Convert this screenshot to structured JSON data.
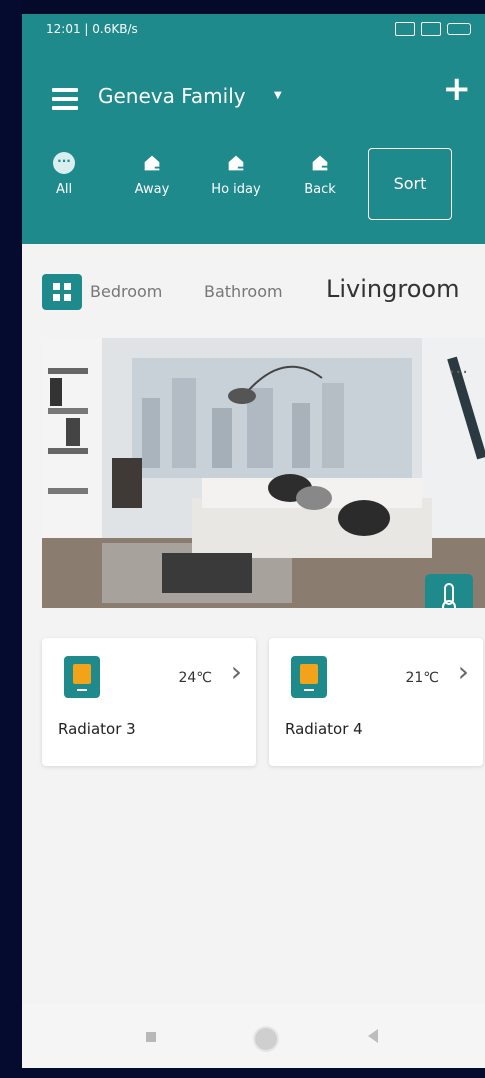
{
  "status_bar": {
    "time_speed": "12:01 | 0.6KB/s",
    "icons": [
      "signal-icon",
      "sim-icon",
      "battery-icon"
    ]
  },
  "header": {
    "family_name": "Geneva Family",
    "add_icon": "plus-icon",
    "menu_icon": "menu-icon"
  },
  "modes": [
    {
      "label": "All",
      "icon": "dots-circle-icon"
    },
    {
      "label": "Away",
      "icon": "house-arrow-out-icon"
    },
    {
      "label": "Ho iday",
      "icon": "house-arrow-in-icon"
    },
    {
      "label": "Back",
      "icon": "house-back-icon"
    }
  ],
  "sort_label": "Sort",
  "rooms": {
    "tabs": [
      "Bedroom",
      "Bathroom",
      "Livingroom"
    ],
    "active": "Livingroom"
  },
  "room_card": {
    "more_label": "···",
    "thermometer_icon": "thermometer-icon"
  },
  "devices": [
    {
      "name": "Radiator 3",
      "temperature": "24℃"
    },
    {
      "name": "Radiator 4",
      "temperature": "21℃"
    }
  ],
  "colors": {
    "accent": "#1e8a8c",
    "device_highlight": "#f2a31a",
    "background": "#f3f3f3"
  }
}
